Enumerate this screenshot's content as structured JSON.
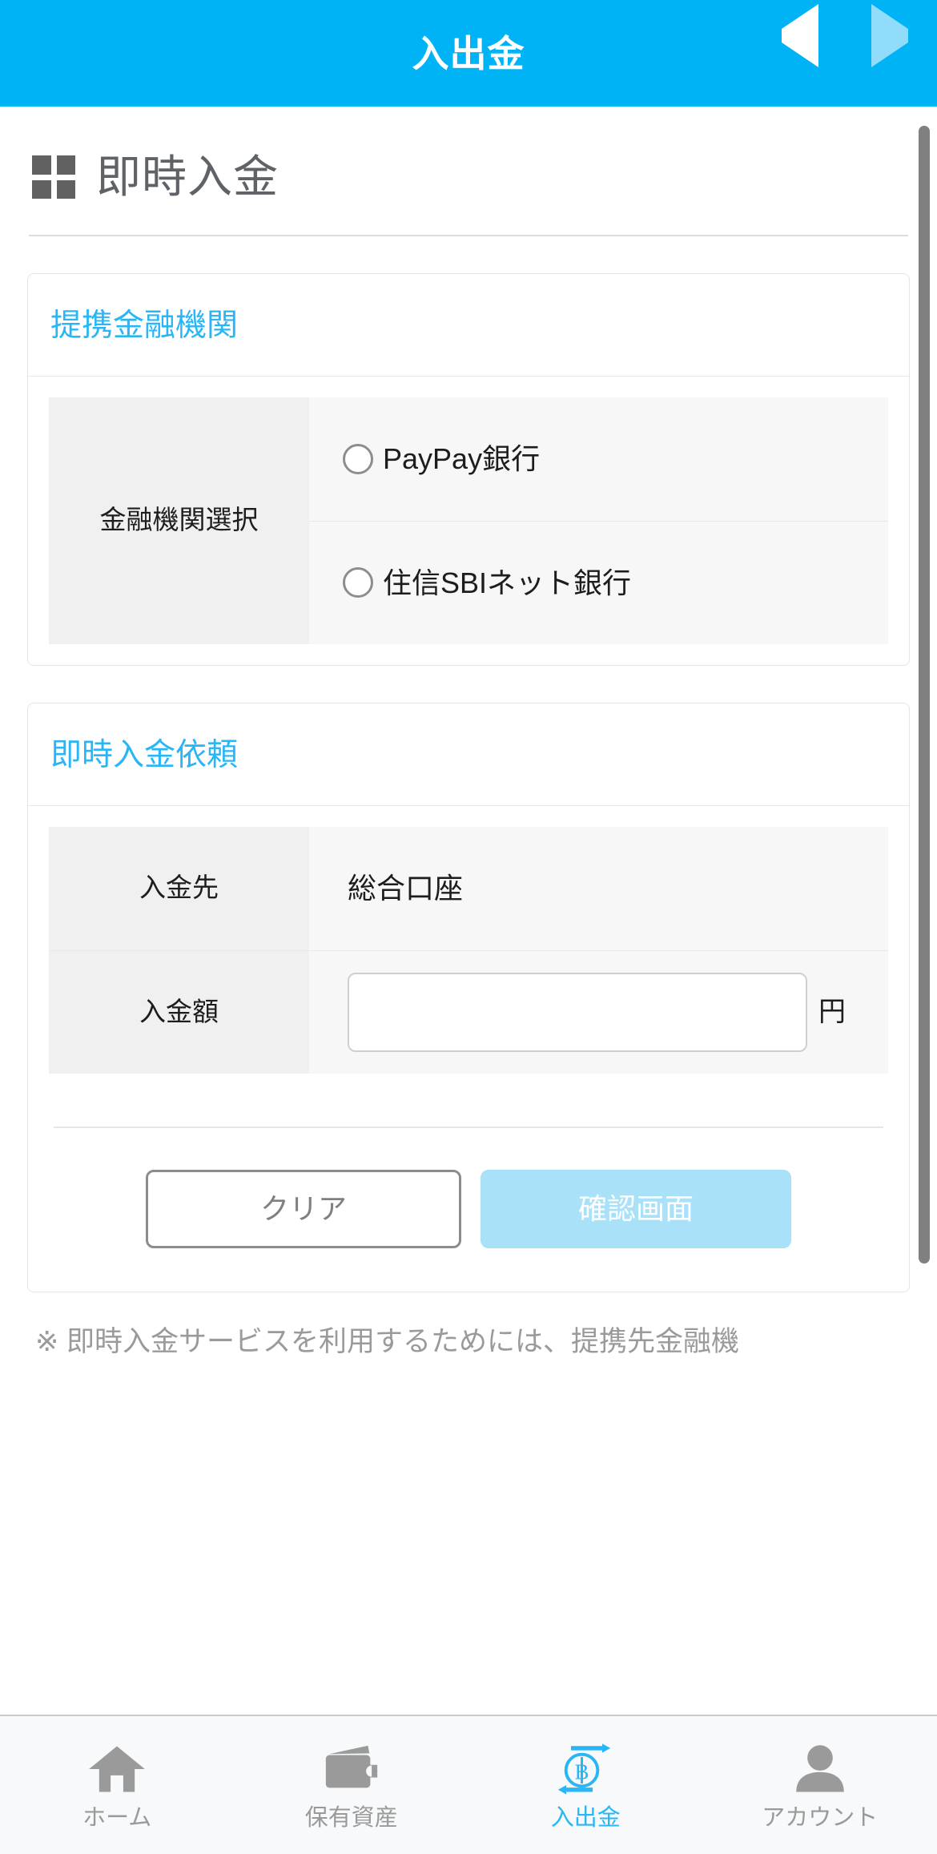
{
  "header": {
    "title": "入出金",
    "prev_icon": "triangle-left-icon",
    "next_icon": "triangle-right-icon",
    "background_color": "#00b3f5"
  },
  "page": {
    "title": "即時入金",
    "icon": "grid-2x2-icon",
    "title_color": "#5f6368"
  },
  "bank_card": {
    "header": "提携金融機関",
    "header_color": "#29b6f6",
    "row_label": "金融機関選択",
    "options": [
      {
        "label": "PayPay銀行",
        "selected": false
      },
      {
        "label": "住信SBIネット銀行",
        "selected": false
      }
    ]
  },
  "deposit_card": {
    "header": "即時入金依頼",
    "header_color": "#29b6f6",
    "rows": [
      {
        "label": "入金先",
        "value": "総合口座",
        "type": "text"
      },
      {
        "label": "入金額",
        "value": "",
        "placeholder": "",
        "unit": "円",
        "type": "input"
      }
    ],
    "buttons": {
      "clear": "クリア",
      "confirm": "確認画面",
      "confirm_color": "#a9e2f8",
      "confirm_disabled": true
    }
  },
  "footnote": "※ 即時入金サービスを利用するためには、提携先金融機",
  "tabbar": {
    "items": [
      {
        "label": "ホーム",
        "icon": "home-icon",
        "active": false
      },
      {
        "label": "保有資産",
        "icon": "wallet-icon",
        "active": false
      },
      {
        "label": "入出金",
        "icon": "bitcoin-transfer-icon",
        "active": true
      },
      {
        "label": "アカウント",
        "icon": "person-icon",
        "active": false
      }
    ],
    "active_color": "#29b6f6",
    "inactive_color": "#9a9a9a"
  }
}
